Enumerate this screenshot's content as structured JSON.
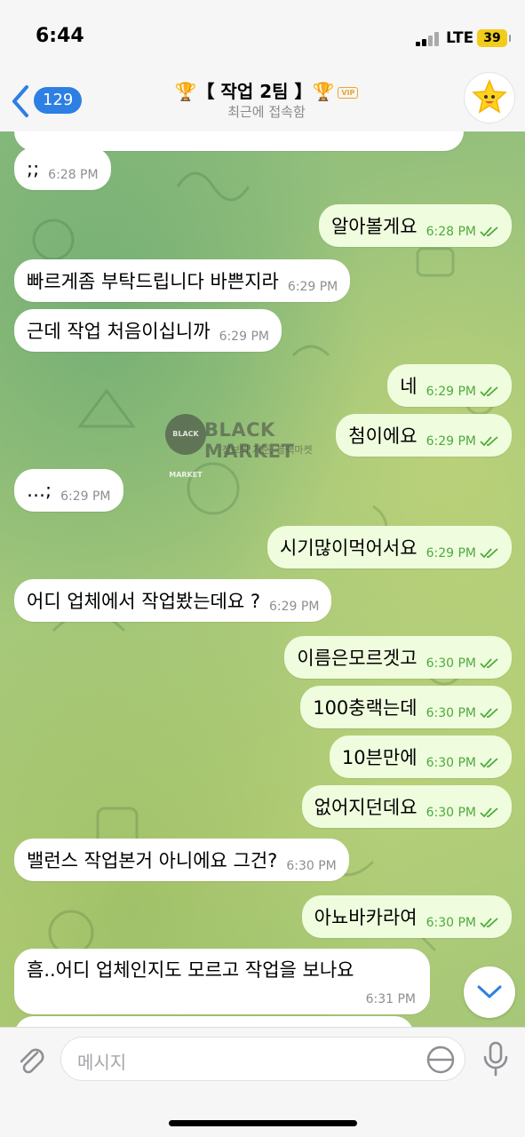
{
  "status_bar": {
    "time": "6:44",
    "network": "LTE",
    "battery": "39"
  },
  "header": {
    "back_count": "129",
    "trophy_left": "🏆",
    "title": "【 작업 2팀 】",
    "trophy_right": "🏆",
    "vip": "VIP",
    "subtitle": "최근에 접속함"
  },
  "watermark": {
    "logo": "BLACK MARKET",
    "text": "BLACK MARKET",
    "tagline": "정보의 기준, 블랙마켓"
  },
  "messages": [
    {
      "dir": "in",
      "text": ";;",
      "time": "6:28 PM"
    },
    {
      "dir": "out",
      "text": "알아볼게요",
      "time": "6:28 PM"
    },
    {
      "dir": "in",
      "text": "빠르게좀 부탁드립니다 바쁜지라",
      "time": "6:29 PM"
    },
    {
      "dir": "in",
      "text": "근데 작업 처음이십니까",
      "time": "6:29 PM"
    },
    {
      "dir": "out",
      "text": "네",
      "time": "6:29 PM"
    },
    {
      "dir": "out",
      "text": "첨이에요",
      "time": "6:29 PM"
    },
    {
      "dir": "in",
      "text": "…;",
      "time": "6:29 PM"
    },
    {
      "dir": "out",
      "text": "시기많이먹어서요",
      "time": "6:29 PM"
    },
    {
      "dir": "in",
      "text": "어디 업체에서 작업봤는데요 ?",
      "time": "6:29 PM"
    },
    {
      "dir": "out",
      "text": "이름은모르겟고",
      "time": "6:30 PM"
    },
    {
      "dir": "out",
      "text": "100충랙는데",
      "time": "6:30 PM"
    },
    {
      "dir": "out",
      "text": "10븐만에",
      "time": "6:30 PM"
    },
    {
      "dir": "out",
      "text": "없어지던데요",
      "time": "6:30 PM"
    },
    {
      "dir": "in",
      "text": "밸런스 작업본거 아니에요 그건?",
      "time": "6:30 PM"
    },
    {
      "dir": "out",
      "text": "아뇨바카라여",
      "time": "6:30 PM"
    },
    {
      "dir": "in",
      "text": "흠..어디 업체인지도 모르고 작업을 보나요",
      "time": "6:31 PM"
    }
  ],
  "input": {
    "placeholder": "메시지"
  },
  "colors": {
    "accent": "#2d7fe3",
    "out_bubble": "#effdde",
    "in_bubble": "#ffffff",
    "out_time": "#4eaa3c"
  }
}
